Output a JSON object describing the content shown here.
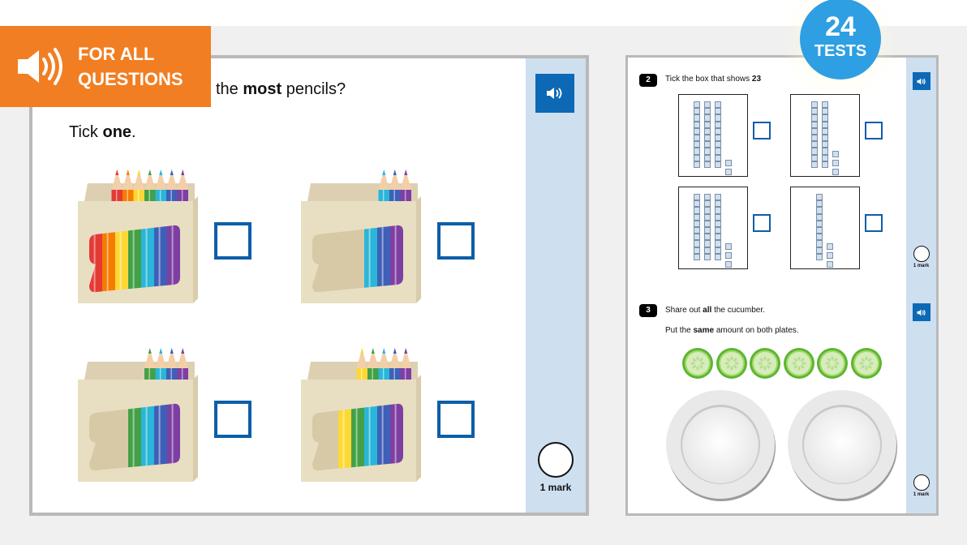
{
  "banner": {
    "icon": "speaker-icon",
    "line1": "FOR ALL",
    "line2": "QUESTIONS",
    "color": "#f17e22"
  },
  "badge": {
    "number": "24",
    "label": "TESTS",
    "color": "#2e9fe3"
  },
  "left_page": {
    "question_partial": "the",
    "question_bold": "most",
    "question_end": "pencils?",
    "instruction_prefix": "Tick",
    "instruction_bold": "one",
    "instruction_end": ".",
    "audio_icon": "speaker-icon",
    "mark_label": "1 mark",
    "options": [
      {
        "name": "box-7-pencils",
        "pencils": [
          "#e53935",
          "#f57c00",
          "#fdd835",
          "#43a047",
          "#29b6d8",
          "#3f5fb8",
          "#7e3fa3"
        ]
      },
      {
        "name": "box-3-pencils",
        "pencils": [
          "#29b6d8",
          "#3f5fb8",
          "#7e3fa3"
        ]
      },
      {
        "name": "box-4-pencils",
        "pencils": [
          "#43a047",
          "#29b6d8",
          "#3f5fb8",
          "#7e3fa3"
        ]
      },
      {
        "name": "box-5-pencils",
        "pencils": [
          "#fdd835",
          "#43a047",
          "#29b6d8",
          "#3f5fb8",
          "#7e3fa3"
        ]
      }
    ]
  },
  "right_page": {
    "q2": {
      "number": "2",
      "text": "Tick the box that shows",
      "value_bold": "23",
      "mark_label": "1 mark",
      "options": [
        {
          "tens": 3,
          "ones": 2
        },
        {
          "tens": 2,
          "ones": 3
        },
        {
          "tens": 3,
          "ones": 3
        },
        {
          "tens": 1,
          "ones": 3
        }
      ]
    },
    "q3": {
      "number": "3",
      "line1_prefix": "Share out",
      "line1_bold": "all",
      "line1_end": "the cucumber.",
      "line2_prefix": "Put the",
      "line2_bold": "same",
      "line2_end": "amount on both plates.",
      "cucumber_slices": 6,
      "plates": 2,
      "mark_label": "1 mark"
    }
  }
}
